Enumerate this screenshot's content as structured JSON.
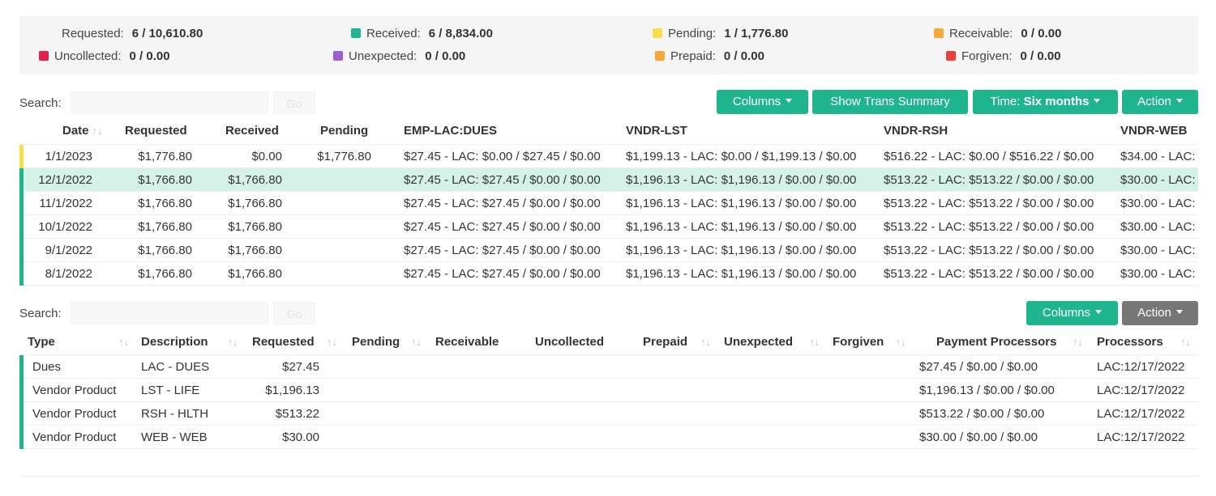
{
  "summary": [
    {
      "label": "Requested:",
      "value": "6 / 10,610.80",
      "color": ""
    },
    {
      "label": "Received:",
      "value": "6 / 8,834.00",
      "color": "#1fb58f"
    },
    {
      "label": "Pending:",
      "value": "1 / 1,776.80",
      "color": "#f7de4b"
    },
    {
      "label": "Receivable:",
      "value": "0 / 0.00",
      "color": "#f6a93b"
    },
    {
      "label": "Uncollected:",
      "value": "0 / 0.00",
      "color": "#e0224c"
    },
    {
      "label": "Unexpected:",
      "value": "0 / 0.00",
      "color": "#9b5fd0"
    },
    {
      "label": "Prepaid:",
      "value": "0 / 0.00",
      "color": "#f6a93b"
    },
    {
      "label": "Forgiven:",
      "value": "0 / 0.00",
      "color": "#e84040"
    }
  ],
  "search": {
    "label": "Search:",
    "go": "Go"
  },
  "toolbar1": {
    "columns": "Columns",
    "show_trans": "Show Trans Summary",
    "time_prefix": "Time:",
    "time_value": "Six months",
    "action": "Action"
  },
  "toolbar2": {
    "columns": "Columns",
    "action": "Action"
  },
  "table1": {
    "headers": [
      "Date",
      "Requested",
      "Received",
      "Pending",
      "EMP-LAC:DUES",
      "VNDR-LST",
      "VNDR-RSH",
      "VNDR-WEB"
    ],
    "rows": [
      {
        "status": "#f7de4b",
        "cells": [
          "1/1/2023",
          "$1,776.80",
          "$0.00",
          "$1,776.80",
          "$27.45 - LAC: $0.00 / $27.45 / $0.00",
          "$1,199.13 - LAC: $0.00 / $1,199.13 / $0.00",
          "$516.22 - LAC: $0.00 / $516.22 / $0.00",
          "$34.00 - LAC:"
        ]
      },
      {
        "status": "#1fb58f",
        "cells": [
          "12/1/2022",
          "$1,766.80",
          "$1,766.80",
          "",
          "$27.45 - LAC: $27.45 / $0.00 / $0.00",
          "$1,196.13 - LAC: $1,196.13 / $0.00 / $0.00",
          "$513.22 - LAC: $513.22 / $0.00 / $0.00",
          "$30.00 - LAC:"
        ]
      },
      {
        "status": "#1fb58f",
        "cells": [
          "11/1/2022",
          "$1,766.80",
          "$1,766.80",
          "",
          "$27.45 - LAC: $27.45 / $0.00 / $0.00",
          "$1,196.13 - LAC: $1,196.13 / $0.00 / $0.00",
          "$513.22 - LAC: $513.22 / $0.00 / $0.00",
          "$30.00 - LAC:"
        ]
      },
      {
        "status": "#1fb58f",
        "cells": [
          "10/1/2022",
          "$1,766.80",
          "$1,766.80",
          "",
          "$27.45 - LAC: $27.45 / $0.00 / $0.00",
          "$1,196.13 - LAC: $1,196.13 / $0.00 / $0.00",
          "$513.22 - LAC: $513.22 / $0.00 / $0.00",
          "$30.00 - LAC:"
        ]
      },
      {
        "status": "#1fb58f",
        "cells": [
          "9/1/2022",
          "$1,766.80",
          "$1,766.80",
          "",
          "$27.45 - LAC: $27.45 / $0.00 / $0.00",
          "$1,196.13 - LAC: $1,196.13 / $0.00 / $0.00",
          "$513.22 - LAC: $513.22 / $0.00 / $0.00",
          "$30.00 - LAC:"
        ]
      },
      {
        "status": "#1fb58f",
        "cells": [
          "8/1/2022",
          "$1,766.80",
          "$1,766.80",
          "",
          "$27.45 - LAC: $27.45 / $0.00 / $0.00",
          "$1,196.13 - LAC: $1,196.13 / $0.00 / $0.00",
          "$513.22 - LAC: $513.22 / $0.00 / $0.00",
          "$30.00 - LAC:"
        ]
      }
    ]
  },
  "table2": {
    "headers": [
      "Type",
      "Description",
      "Requested",
      "Pending",
      "Receivable",
      "Uncollected",
      "Prepaid",
      "Unexpected",
      "Forgiven",
      "Payment Processors",
      "Processors"
    ],
    "rows": [
      {
        "status": "#1fb58f",
        "cells": [
          "Dues",
          "LAC - DUES",
          "$27.45",
          "",
          "",
          "",
          "",
          "",
          "",
          "$27.45 / $0.00 / $0.00",
          "LAC:12/17/2022"
        ]
      },
      {
        "status": "#1fb58f",
        "cells": [
          "Vendor Product",
          "LST - LIFE",
          "$1,196.13",
          "",
          "",
          "",
          "",
          "",
          "",
          "$1,196.13 / $0.00 / $0.00",
          "LAC:12/17/2022"
        ]
      },
      {
        "status": "#1fb58f",
        "cells": [
          "Vendor Product",
          "RSH - HLTH",
          "$513.22",
          "",
          "",
          "",
          "",
          "",
          "",
          "$513.22 / $0.00 / $0.00",
          "LAC:12/17/2022"
        ]
      },
      {
        "status": "#1fb58f",
        "cells": [
          "Vendor Product",
          "WEB - WEB",
          "$30.00",
          "",
          "",
          "",
          "",
          "",
          "",
          "$30.00 / $0.00 / $0.00",
          "LAC:12/17/2022"
        ]
      }
    ]
  }
}
